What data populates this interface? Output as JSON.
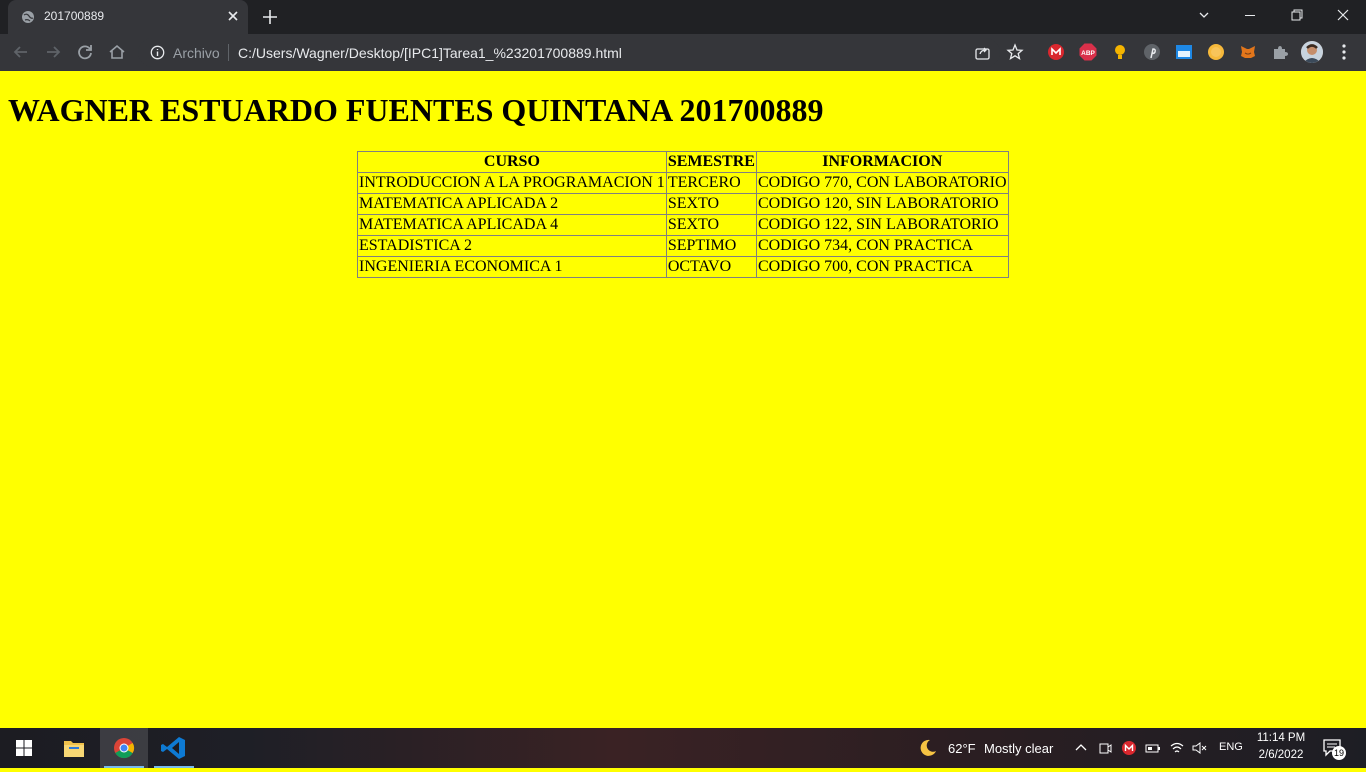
{
  "browser": {
    "tab_title": "201700889",
    "scheme_label": "Archivo",
    "url": "C:/Users/Wagner/Desktop/[IPC1]Tarea1_%23201700889.html",
    "extensions": [
      "mega-icon",
      "adblock-plus-icon",
      "lightbulb-icon",
      "pinterest-icon",
      "window-ext-icon",
      "coin-icon",
      "metamask-icon",
      "puzzle-icon"
    ],
    "ext_abp_label": "ABP"
  },
  "page": {
    "heading": "WAGNER ESTUARDO FUENTES QUINTANA 201700889",
    "table": {
      "headers": [
        "CURSO",
        "SEMESTRE",
        "INFORMACION"
      ],
      "rows": [
        [
          "INTRODUCCION A LA PROGRAMACION 1",
          "TERCERO",
          "CODIGO 770, CON LABORATORIO"
        ],
        [
          "MATEMATICA APLICADA 2",
          "SEXTO",
          "CODIGO 120, SIN LABORATORIO"
        ],
        [
          "MATEMATICA APLICADA 4",
          "SEXTO",
          "CODIGO 122, SIN LABORATORIO"
        ],
        [
          "ESTADISTICA 2",
          "SEPTIMO",
          "CODIGO 734, CON PRACTICA"
        ],
        [
          "INGENIERIA ECONOMICA 1",
          "OCTAVO",
          "CODIGO 700, CON PRACTICA"
        ]
      ]
    },
    "background_color": "#ffff00"
  },
  "taskbar": {
    "weather_temp": "62°F",
    "weather_desc": "Mostly clear",
    "language": "ENG",
    "time": "11:14 PM",
    "date": "2/6/2022",
    "notification_count": "19"
  }
}
